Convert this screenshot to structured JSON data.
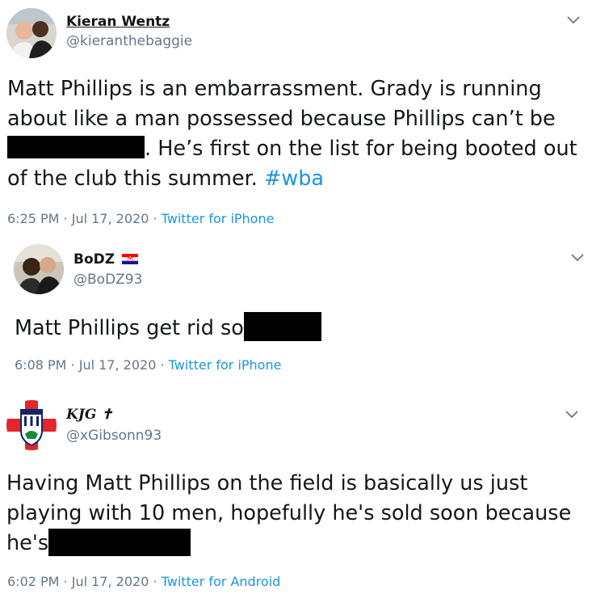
{
  "tweets": [
    {
      "name": "Kieran Wentz",
      "handle": "@kieranthebaggie",
      "text_a": "Matt Phillips is an embarrassment. Grady is running about like a man possessed because Phillips can’t be",
      "text_b": ". He’s first on the list for being booted out of the club this summer.",
      "hashtag": "#wba",
      "time": "6:25 PM · Jul 17, 2020 ·",
      "source": "Twitter for iPhone"
    },
    {
      "name": "BoDZ",
      "handle": "@BoDZ93",
      "text_a": "Matt Phillips get rid so",
      "time": "6:08 PM · Jul 17, 2020 ·",
      "source": "Twitter for iPhone"
    },
    {
      "name": "KJG ✝",
      "handle": "@xGibsonn93",
      "text_a": "Having Matt Phillips on the field is basically us just playing with 10 men, hopefully he's sold soon because he's",
      "time": "6:02 PM · Jul 17, 2020 ·",
      "source": "Twitter for Android"
    }
  ]
}
